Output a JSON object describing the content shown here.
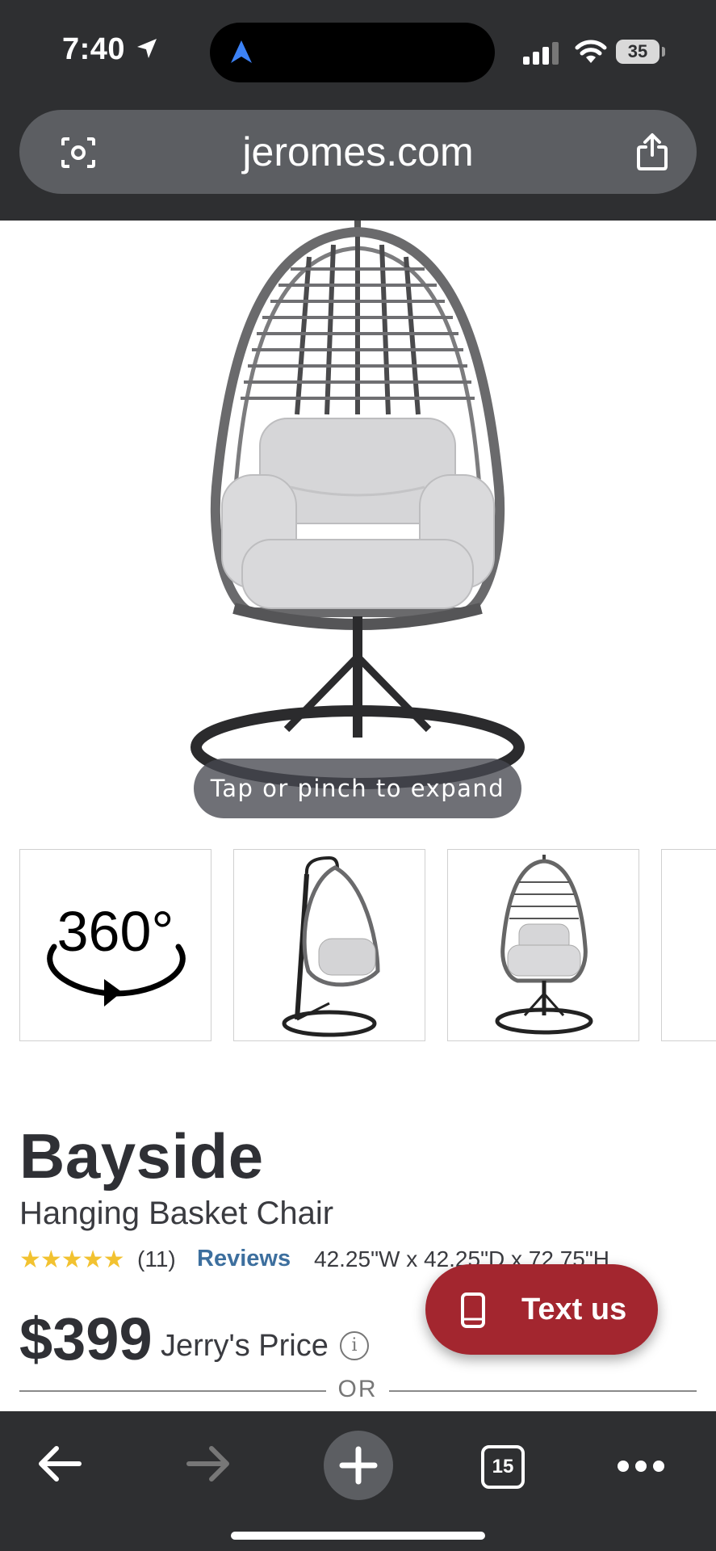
{
  "status_bar": {
    "time": "7:40",
    "battery": "35"
  },
  "browser": {
    "url": "jeromes.com",
    "tab_count": "15"
  },
  "hero": {
    "expand_hint": "Tap or pinch to expand"
  },
  "thumbnails": [
    {
      "label": "360°",
      "type": "360-view"
    },
    {
      "type": "side-view"
    },
    {
      "type": "front-view"
    },
    {
      "type": "partial"
    }
  ],
  "product": {
    "name": "Bayside",
    "subtitle": "Hanging Basket Chair",
    "stars": "★★★★★",
    "rating": 5,
    "review_count": "(11)",
    "reviews_link": "Reviews",
    "dimensions": "42.25\"W x 42.25\"D x 72.75\"H",
    "price": "$399",
    "price_label": "Jerry's Price",
    "or_text": "OR"
  },
  "chat": {
    "label": "Text us"
  },
  "colors": {
    "chrome": "#2e2f31",
    "url_bar": "#5c5e62",
    "text_us": "#a3262f",
    "stars": "#f2c230",
    "link": "#3d6f9e"
  }
}
